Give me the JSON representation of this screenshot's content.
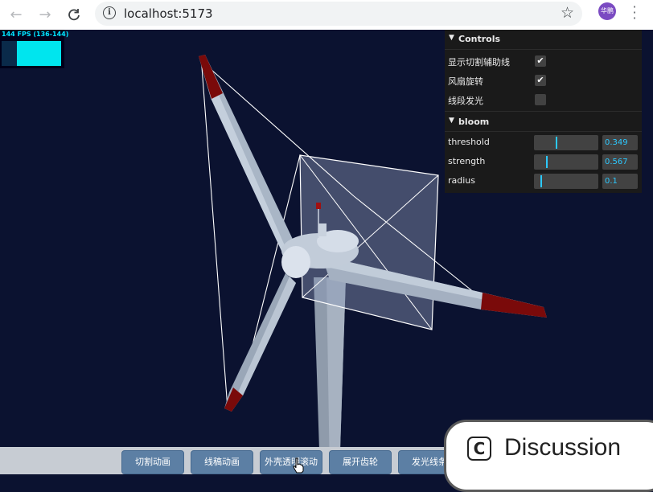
{
  "browser": {
    "back_icon": "arrow-left-icon",
    "forward_icon": "arrow-right-icon",
    "reload_icon": "reload-icon",
    "url": "localhost:5173",
    "profile_initials": "华鹏"
  },
  "fps_meter": {
    "label": "144 FPS (136-144)",
    "color": "#00e5ff"
  },
  "gui": {
    "controls": {
      "title": "Controls",
      "items": [
        {
          "label": "显示切割辅助线",
          "checked": true
        },
        {
          "label": "风扇旋转",
          "checked": true
        },
        {
          "label": "线段发光",
          "checked": false
        }
      ]
    },
    "bloom": {
      "title": "bloom",
      "items": [
        {
          "label": "threshold",
          "value": "0.349",
          "fraction": 0.349
        },
        {
          "label": "strength",
          "value": "0.567",
          "fraction": 0.19
        },
        {
          "label": "radius",
          "value": "0.1",
          "fraction": 0.1
        }
      ]
    },
    "accent": "#2cc9ff"
  },
  "toolbar": {
    "buttons": [
      {
        "label": "切割动画"
      },
      {
        "label": "线稿动画"
      },
      {
        "label": "外壳透明滚动"
      },
      {
        "label": "展开齿轮"
      },
      {
        "label": "发光线条"
      }
    ]
  },
  "discussion": {
    "icon_letter": "C",
    "label": "Discussion"
  },
  "colors": {
    "scene_bg": "#0b1230",
    "blade": "#a9b6c6",
    "blade_tip": "#7a0a0a",
    "button_bg": "#5c7fa4"
  }
}
